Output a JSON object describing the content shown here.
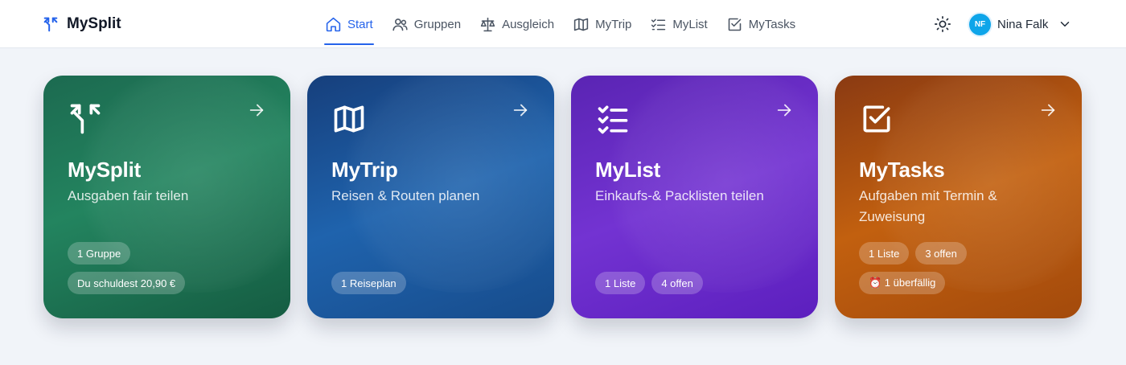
{
  "brand": {
    "name": "MySplit",
    "icon": "split-arrow-icon"
  },
  "nav": {
    "items": [
      {
        "label": "Start",
        "icon": "home-icon",
        "active": true
      },
      {
        "label": "Gruppen",
        "icon": "users-icon"
      },
      {
        "label": "Ausgleich",
        "icon": "scale-icon"
      },
      {
        "label": "MyTrip",
        "icon": "map-icon"
      },
      {
        "label": "MyList",
        "icon": "list-check-icon"
      },
      {
        "label": "MyTasks",
        "icon": "square-check-icon"
      }
    ],
    "accent_color": "#2563eb"
  },
  "theme_toggle": {
    "icon": "sun-icon"
  },
  "user": {
    "initials": "NF",
    "name": "Nina Falk",
    "avatar_color": "#0ea5e9"
  },
  "cards": [
    {
      "title": "MySplit",
      "subtitle": "Ausgaben fair teilen",
      "icon": "split-arrow-icon",
      "color": "#1f7a58",
      "badges": [
        [
          "1 Gruppe"
        ],
        [
          "Du schuldest 20,90 €"
        ]
      ]
    },
    {
      "title": "MyTrip",
      "subtitle": "Reisen & Routen planen",
      "icon": "map-icon",
      "color": "#1d5aa3",
      "badges": [
        [
          "1 Reiseplan"
        ]
      ]
    },
    {
      "title": "MyList",
      "subtitle": "Einkaufs-& Packlisten teilen",
      "icon": "list-check-icon",
      "color": "#6d2ec9",
      "badges": [
        [
          "1 Liste",
          "4 offen"
        ]
      ]
    },
    {
      "title": "MyTasks",
      "subtitle": "Aufgaben mit Termin & Zuweisung",
      "icon": "square-check-icon",
      "color": "#b5560f",
      "badges": [
        [
          "1 Liste",
          "3 offen"
        ],
        [
          "⏰ 1 überfällig"
        ]
      ]
    }
  ]
}
